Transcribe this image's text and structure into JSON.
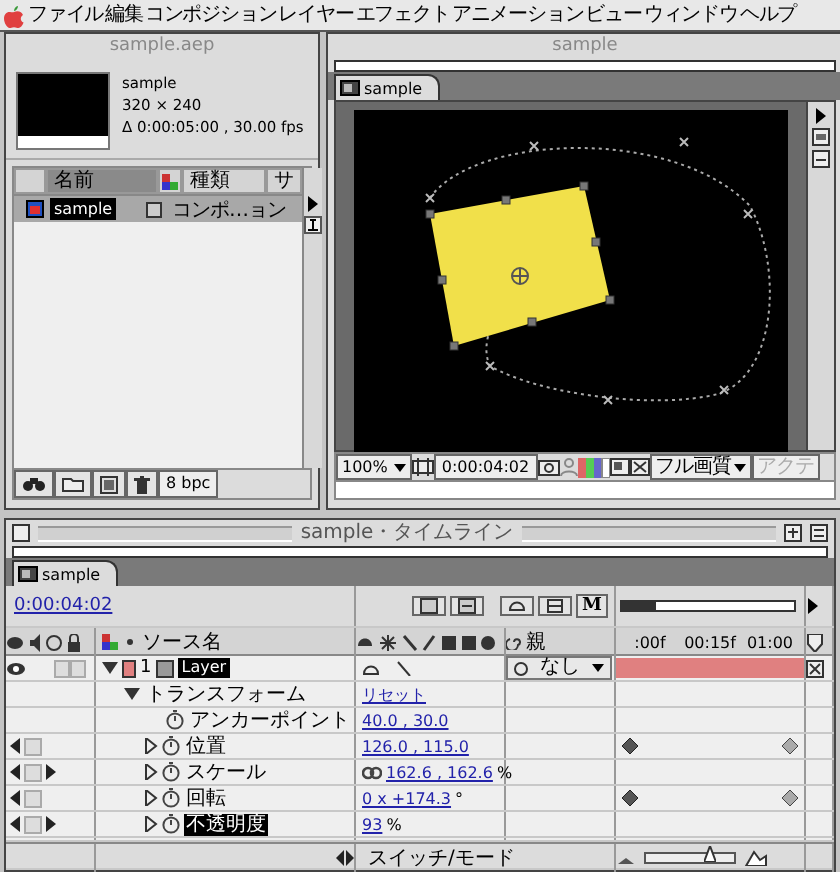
{
  "menu": [
    "ファイル",
    "編集",
    "コンポジション",
    "レイヤー",
    "エフェクト",
    "アニメーション",
    "ビュー",
    "ウィンドウ",
    "ヘルプ"
  ],
  "project": {
    "title": "sample.aep",
    "item_name": "sample",
    "dimensions": "320 × 240",
    "duration": "Δ 0:00:05:00 , 30.00 fps",
    "columns": [
      "名前",
      "種類",
      "サ"
    ],
    "rows": [
      {
        "name": "sample",
        "type": "コンポ…ョン",
        "selected": true
      }
    ],
    "bit_depth": "8 bpc"
  },
  "composition": {
    "title": "sample",
    "tab": "sample",
    "zoom": "100%",
    "time": "0:00:04:02",
    "quality": "フル画質",
    "view_button": {
      "label": "アクテ",
      "disabled": true
    }
  },
  "timeline": {
    "title": "sample・タイムライン",
    "tab": "sample",
    "time": "0:00:04:02",
    "marker_button": "M",
    "source_column": "ソース名",
    "parent_column": "親",
    "ruler": [
      ":00f",
      "00:15f",
      "01:00"
    ],
    "navigator": {
      "level": 0.2
    },
    "zoom_slider": {
      "level": 0.75
    },
    "layer": {
      "index": "1",
      "name": "Layer",
      "selected": true,
      "color": "#e08080",
      "parent": "なし"
    },
    "group": {
      "name": "トランスフォーム",
      "expanded": true,
      "reset": "リセット"
    },
    "properties": [
      {
        "name": "アンカーポイント",
        "value": "40.0 , 30.0",
        "expandable": false,
        "selected": false,
        "linked": false,
        "nav_prev": false,
        "nav_next": false,
        "keyframed": false
      },
      {
        "name": "位置",
        "value": "126.0 , 115.0",
        "expandable": true,
        "selected": false,
        "linked": false,
        "nav_prev": true,
        "nav_next": false,
        "keyframed": true
      },
      {
        "name": "スケール",
        "value": "162.6 , 162.6",
        "unit": "%",
        "expandable": true,
        "selected": false,
        "linked": true,
        "nav_prev": true,
        "nav_next": true,
        "keyframed": false
      },
      {
        "name": "回転",
        "value": "0 x +174.3",
        "unit": "°",
        "expandable": true,
        "selected": false,
        "linked": false,
        "nav_prev": true,
        "nav_next": false,
        "keyframed": true
      },
      {
        "name": "不透明度",
        "value": "93",
        "unit": "%",
        "expandable": true,
        "selected": true,
        "linked": false,
        "nav_prev": true,
        "nav_next": true,
        "keyframed": false
      }
    ],
    "switch_mode": "スイッチ/モード"
  }
}
